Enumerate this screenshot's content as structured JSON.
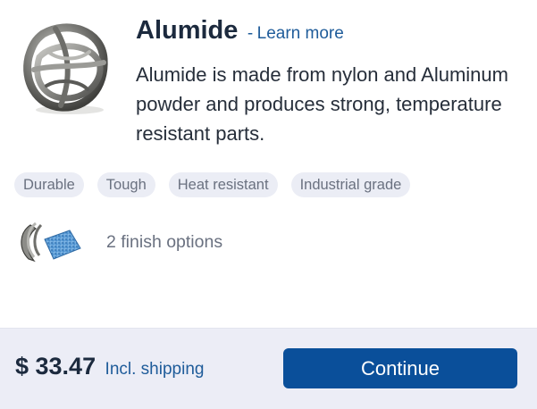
{
  "material": {
    "title": "Alumide",
    "separator": "-",
    "learn_more": "Learn more",
    "description": "Alumide is made from nylon and Aluminum powder and produces strong, temperature resistant parts.",
    "image_icon": "alumide-sample-part-icon"
  },
  "tags": [
    "Durable",
    "Tough",
    "Heat resistant",
    "Industrial grade"
  ],
  "finish": {
    "label": "2 finish options",
    "icon": "finish-samples-icon"
  },
  "footer": {
    "price": "$ 33.47",
    "price_note": "Incl. shipping",
    "continue_label": "Continue"
  },
  "colors": {
    "accent": "#0a4f9a",
    "link": "#1f5c9a",
    "tag_bg": "#ebedf5",
    "footer_bg": "#ecedf6",
    "title": "#1c2a3e"
  }
}
